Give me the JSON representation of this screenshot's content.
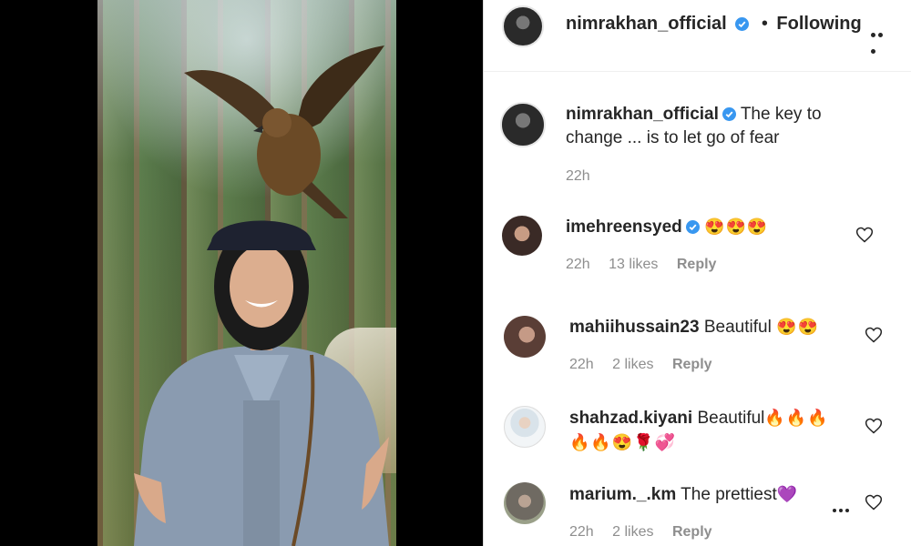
{
  "header": {
    "username": "nimrakhan_official",
    "separator": "•",
    "follow_label": "Following"
  },
  "caption": {
    "username": "nimrakhan_official",
    "text": "The key to change ... is to let go of fear",
    "time": "22h"
  },
  "comments": [
    {
      "username": "imehreensyed",
      "text": "",
      "emoji": "😍😍😍",
      "time": "22h",
      "likes": "13 likes",
      "reply": "Reply"
    },
    {
      "username": "mahiihussain23",
      "text": "Beautiful",
      "emoji": "😍😍",
      "time": "22h",
      "likes": "2 likes",
      "reply": "Reply"
    },
    {
      "username": "shahzad.kiyani",
      "text": "Beautiful",
      "emoji": "🔥🔥🔥",
      "emoji2": "🔥🔥😍🌹💞",
      "time": "",
      "likes": "",
      "reply": ""
    },
    {
      "username": "marium._.km",
      "text": "The prettiest",
      "emoji": "💜",
      "time": "22h",
      "likes": "2 likes",
      "reply": "Reply"
    }
  ],
  "colors": {
    "verified": "#3897f0",
    "text": "#262626",
    "meta": "#8e8e8e"
  },
  "icons": [
    "verified-badge-icon",
    "more-options-icon",
    "heart-icon"
  ]
}
